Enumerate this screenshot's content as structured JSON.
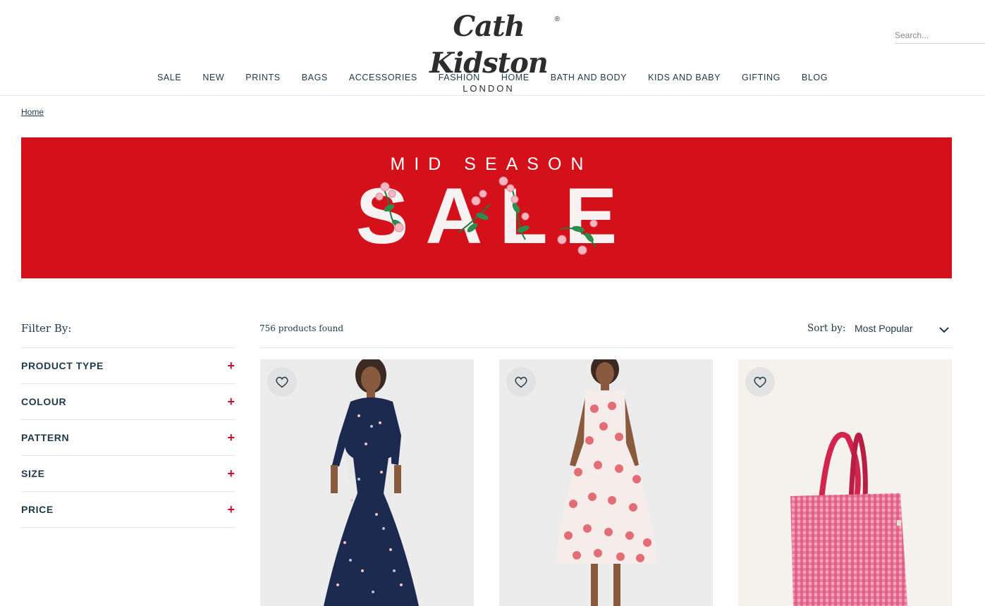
{
  "brand": {
    "name": "Cath Kidston",
    "sub": "LONDON",
    "reg": "®"
  },
  "search": {
    "placeholder": "Search..."
  },
  "nav": [
    "SALE",
    "NEW",
    "PRINTS",
    "BAGS",
    "ACCESSORIES",
    "FASHION",
    "HOME",
    "BATH AND BODY",
    "KIDS AND BABY",
    "GIFTING",
    "BLOG"
  ],
  "breadcrumb": {
    "home": "Home"
  },
  "banner": {
    "top": "MID SEASON",
    "main": "SALE",
    "bg_color": "#d4111b"
  },
  "filters": {
    "title": "Filter By:",
    "items": [
      "PRODUCT TYPE",
      "COLOUR",
      "PATTERN",
      "SIZE",
      "PRICE"
    ],
    "expand_glyph": "+"
  },
  "results": {
    "count": "756 products found",
    "sort_label": "Sort by:",
    "sort_value": "Most Popular"
  },
  "products": [
    {
      "name": "navy-butterfly-dress",
      "icon": "heart-icon"
    },
    {
      "name": "rose-print-dress",
      "icon": "heart-icon"
    },
    {
      "name": "pink-gingham-tote",
      "icon": "heart-icon"
    }
  ],
  "colors": {
    "accent": "#c8102e",
    "text": "#1d3a4a",
    "banner": "#d4111b"
  }
}
